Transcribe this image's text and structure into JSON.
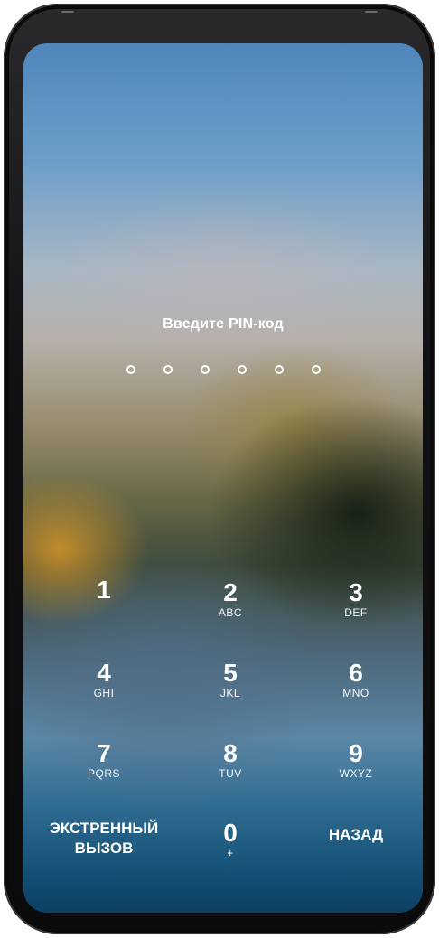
{
  "lock_screen": {
    "prompt": "Введите PIN-код",
    "pin_length": 6,
    "entered_digits": 0
  },
  "keypad": {
    "keys": [
      {
        "digit": "1",
        "letters": ""
      },
      {
        "digit": "2",
        "letters": "ABC"
      },
      {
        "digit": "3",
        "letters": "DEF"
      },
      {
        "digit": "4",
        "letters": "GHI"
      },
      {
        "digit": "5",
        "letters": "JKL"
      },
      {
        "digit": "6",
        "letters": "MNO"
      },
      {
        "digit": "7",
        "letters": "PQRS"
      },
      {
        "digit": "8",
        "letters": "TUV"
      },
      {
        "digit": "9",
        "letters": "WXYZ"
      },
      {
        "digit": "0",
        "letters": "+"
      }
    ],
    "emergency_line1": "ЭКСТРЕННЫЙ",
    "emergency_line2": "ВЫЗОВ",
    "back_label": "НАЗАД"
  },
  "colors": {
    "text": "#ffffff",
    "wallpaper_top": "#4f86bb",
    "wallpaper_bottom": "#0e4063"
  }
}
